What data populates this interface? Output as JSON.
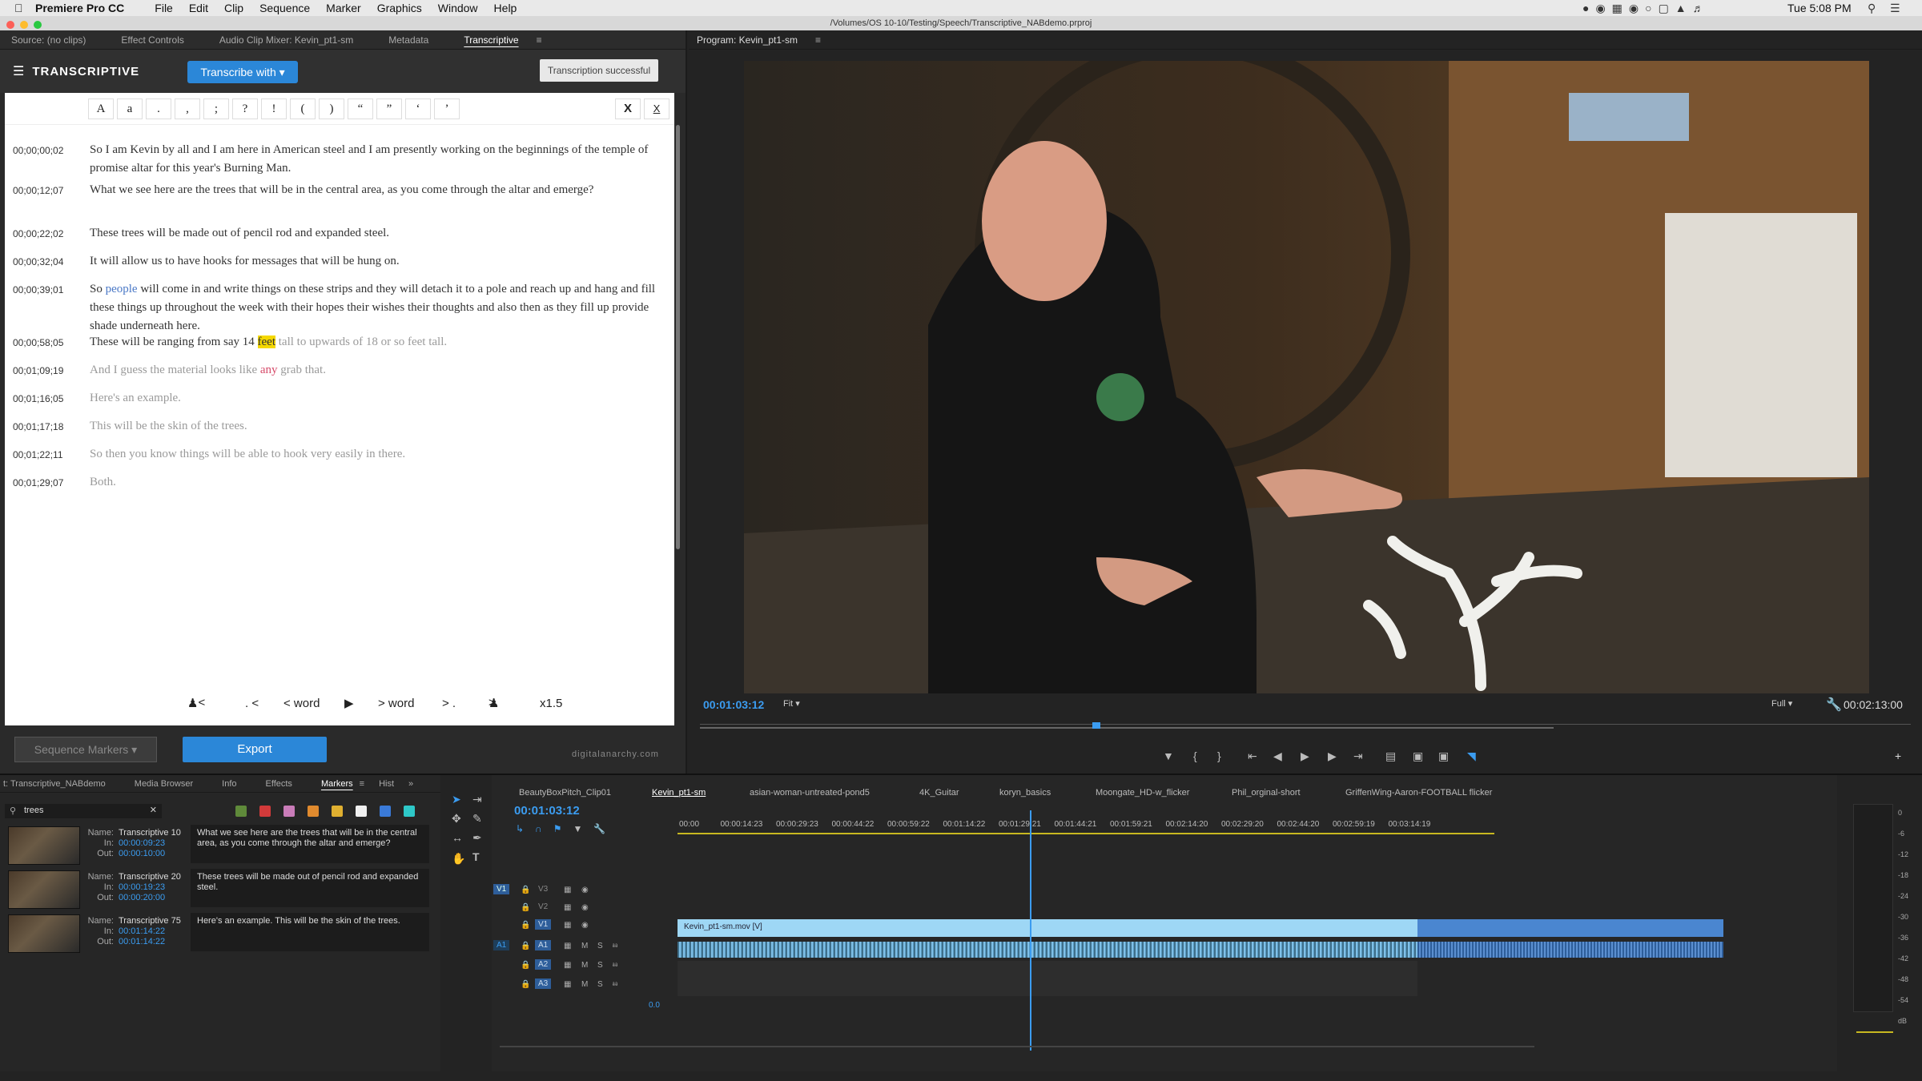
{
  "menubar": {
    "apple": "",
    "app": "Premiere Pro CC",
    "items": [
      "File",
      "Edit",
      "Clip",
      "Sequence",
      "Marker",
      "Graphics",
      "Window",
      "Help"
    ],
    "clock": "Tue 5:08 PM"
  },
  "titlebar": {
    "path": "/Volumes/OS 10-10/Testing/Speech/Transcriptive_NABdemo.prproj"
  },
  "left_tabs": [
    "Source: (no clips)",
    "Effect Controls",
    "Audio Clip Mixer: Kevin_pt1-sm",
    "Metadata",
    "Transcriptive"
  ],
  "transcriptive": {
    "brand": "TRANSCRIPTIVE",
    "transcribe_label": "Transcribe with",
    "status": "Transcription successful",
    "punct": [
      "A",
      "a",
      ".",
      ",",
      ";",
      "?",
      "!",
      "(",
      ")",
      "“",
      "”",
      "‘",
      "’"
    ],
    "close1": "X",
    "close2": "X"
  },
  "transcript": [
    {
      "tc": "00;00;00;02",
      "text": "So I am Kevin by all and I am here in American steel and I am presently working on the beginnings of the temple of promise altar for this year's Burning Man.",
      "state": "normal"
    },
    {
      "tc": "00;00;12;07",
      "text": "What we see here are the trees that will be in the central area, as you come through the altar and emerge?",
      "state": "normal"
    },
    {
      "tc": "00;00;22;02",
      "text": "These trees will be made out of pencil rod and expanded steel.",
      "state": "normal"
    },
    {
      "tc": "00;00;32;04",
      "text": "It will allow us to have hooks for messages that will be hung on.",
      "state": "normal"
    },
    {
      "tc": "00;00;39;01",
      "pre": "So ",
      "link": "people",
      "text": " will come in and write things on these strips and they will detach it to a pole and reach up and hang and fill these things up throughout the week with their hopes their wishes their thoughts and also then as they fill up provide shade underneath here.",
      "state": "normal"
    },
    {
      "tc": "00;00;58;05",
      "pre": "These will be ranging from say 14 ",
      "hl": "feet",
      "text": " tall to upwards of 18 or so feet tall.",
      "state": "mixed"
    },
    {
      "tc": "00;01;09;19",
      "pre": "And I guess the material looks like ",
      "red": "any",
      "text": " grab that.",
      "state": "grey"
    },
    {
      "tc": "00;01;16;05",
      "text": "Here's an example.",
      "state": "grey"
    },
    {
      "tc": "00;01;17;18",
      "text": "This will be the skin of the trees.",
      "state": "grey"
    },
    {
      "tc": "00;01;22;11",
      "text": "So then you know things will be able to hook very easily in there.",
      "state": "grey"
    },
    {
      "tc": "00;01;29;07",
      "text": "Both.",
      "state": "grey"
    }
  ],
  "nav": {
    "prev_speaker": "<",
    "prev_sentence": ". <",
    "prev_word": "< word",
    "play": "▶",
    "next_word": "> word",
    "next_sentence": "> .",
    "next_speaker": ">",
    "speed": "x1.5"
  },
  "footer": {
    "seq_markers": "Sequence Markers",
    "export": "Export",
    "credit": "digitalanarchy.com"
  },
  "program": {
    "title": "Program: Kevin_pt1-sm",
    "timecode": "00:01:03:12",
    "fit": "Fit",
    "quality": "Full",
    "duration": "00:02:13:00"
  },
  "project": {
    "tabs": [
      "t: Transcriptive_NABdemo",
      "Media Browser",
      "Info",
      "Effects",
      "Markers",
      "Hist"
    ],
    "search": "trees",
    "swatches": [
      "#5f8a3a",
      "#d23a3a",
      "#c97cb8",
      "#e08a2e",
      "#e0b030",
      "#f0f0f0",
      "#3a7ad8",
      "#2ec8c8"
    ],
    "markers": [
      {
        "name": "Transcriptive 10",
        "in": "00:00:09:23",
        "out": "00:00:10:00",
        "comment": "What we see here are the trees that will be in the central area, as you come through the altar and emerge?"
      },
      {
        "name": "Transcriptive 20",
        "in": "00:00:19:23",
        "out": "00:00:20:00",
        "comment": "These trees will be made out of pencil rod and expanded steel."
      },
      {
        "name": "Transcriptive 75",
        "in": "00:01:14:22",
        "out": "00:01:14:22",
        "comment": "Here's an example.  This will be the skin of the trees."
      }
    ],
    "labels": {
      "name": "Name:",
      "in": "In:",
      "out": "Out:"
    }
  },
  "timeline": {
    "tabs": [
      "BeautyBoxPitch_Clip01",
      "Kevin_pt1-sm",
      "asian-woman-untreated-pond5",
      "4K_Guitar",
      "koryn_basics",
      "Moongate_HD-w_flicker",
      "Phil_orginal-short",
      "GriffenWing-Aaron-FOOTBALL flicker"
    ],
    "timecode": "00:01:03:12",
    "ruler": [
      "00:00",
      "00:00:14:23",
      "00:00:29:23",
      "00:00:44:22",
      "00:00:59:22",
      "00:01:14:22",
      "00:01:29:21",
      "00:01:44:21",
      "00:01:59:21",
      "00:02:14:20",
      "00:02:29:20",
      "00:02:44:20",
      "00:02:59:19",
      "00:03:14:19"
    ],
    "tracks": [
      "V3",
      "V2",
      "V1",
      "A1",
      "A2",
      "A3"
    ],
    "clip": "Kevin_pt1-sm.mov [V]",
    "master": "0.0",
    "meter": [
      "0",
      "-6",
      "-12",
      "-18",
      "-24",
      "-30",
      "-36",
      "-42",
      "-48",
      "-54",
      "dB"
    ]
  }
}
